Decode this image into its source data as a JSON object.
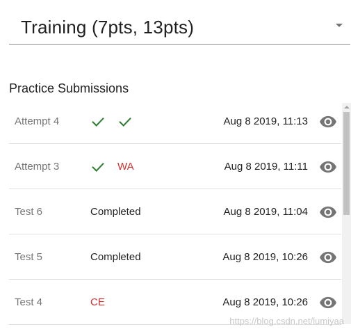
{
  "problem_select": {
    "value": "Training (7pts, 13pts)",
    "arrow_icon": "caret-down-icon"
  },
  "section_title": "Practice Submissions",
  "submissions": [
    {
      "name": "Attempt 4",
      "results": [
        {
          "type": "check"
        },
        {
          "type": "check"
        }
      ],
      "date": "Aug 8 2019, 11:13"
    },
    {
      "name": "Attempt 3",
      "results": [
        {
          "type": "check"
        },
        {
          "type": "text",
          "text": "WA"
        }
      ],
      "date": "Aug 8 2019, 11:11"
    },
    {
      "name": "Test 6",
      "results": [
        {
          "type": "text",
          "text": "Completed"
        }
      ],
      "date": "Aug 8 2019, 11:04"
    },
    {
      "name": "Test 5",
      "results": [
        {
          "type": "text",
          "text": "Completed"
        }
      ],
      "date": "Aug 8 2019, 10:26"
    },
    {
      "name": "Test 4",
      "results": [
        {
          "type": "text",
          "text": "CE"
        }
      ],
      "date": "Aug 8 2019, 10:26"
    }
  ],
  "view_icon": "eye-icon",
  "colors": {
    "check": "#2e7d32",
    "error": "#d32f2f",
    "muted": "#757575",
    "icon": "#757575"
  },
  "watermark": "https://blog.csdn.net/lumiyaa"
}
